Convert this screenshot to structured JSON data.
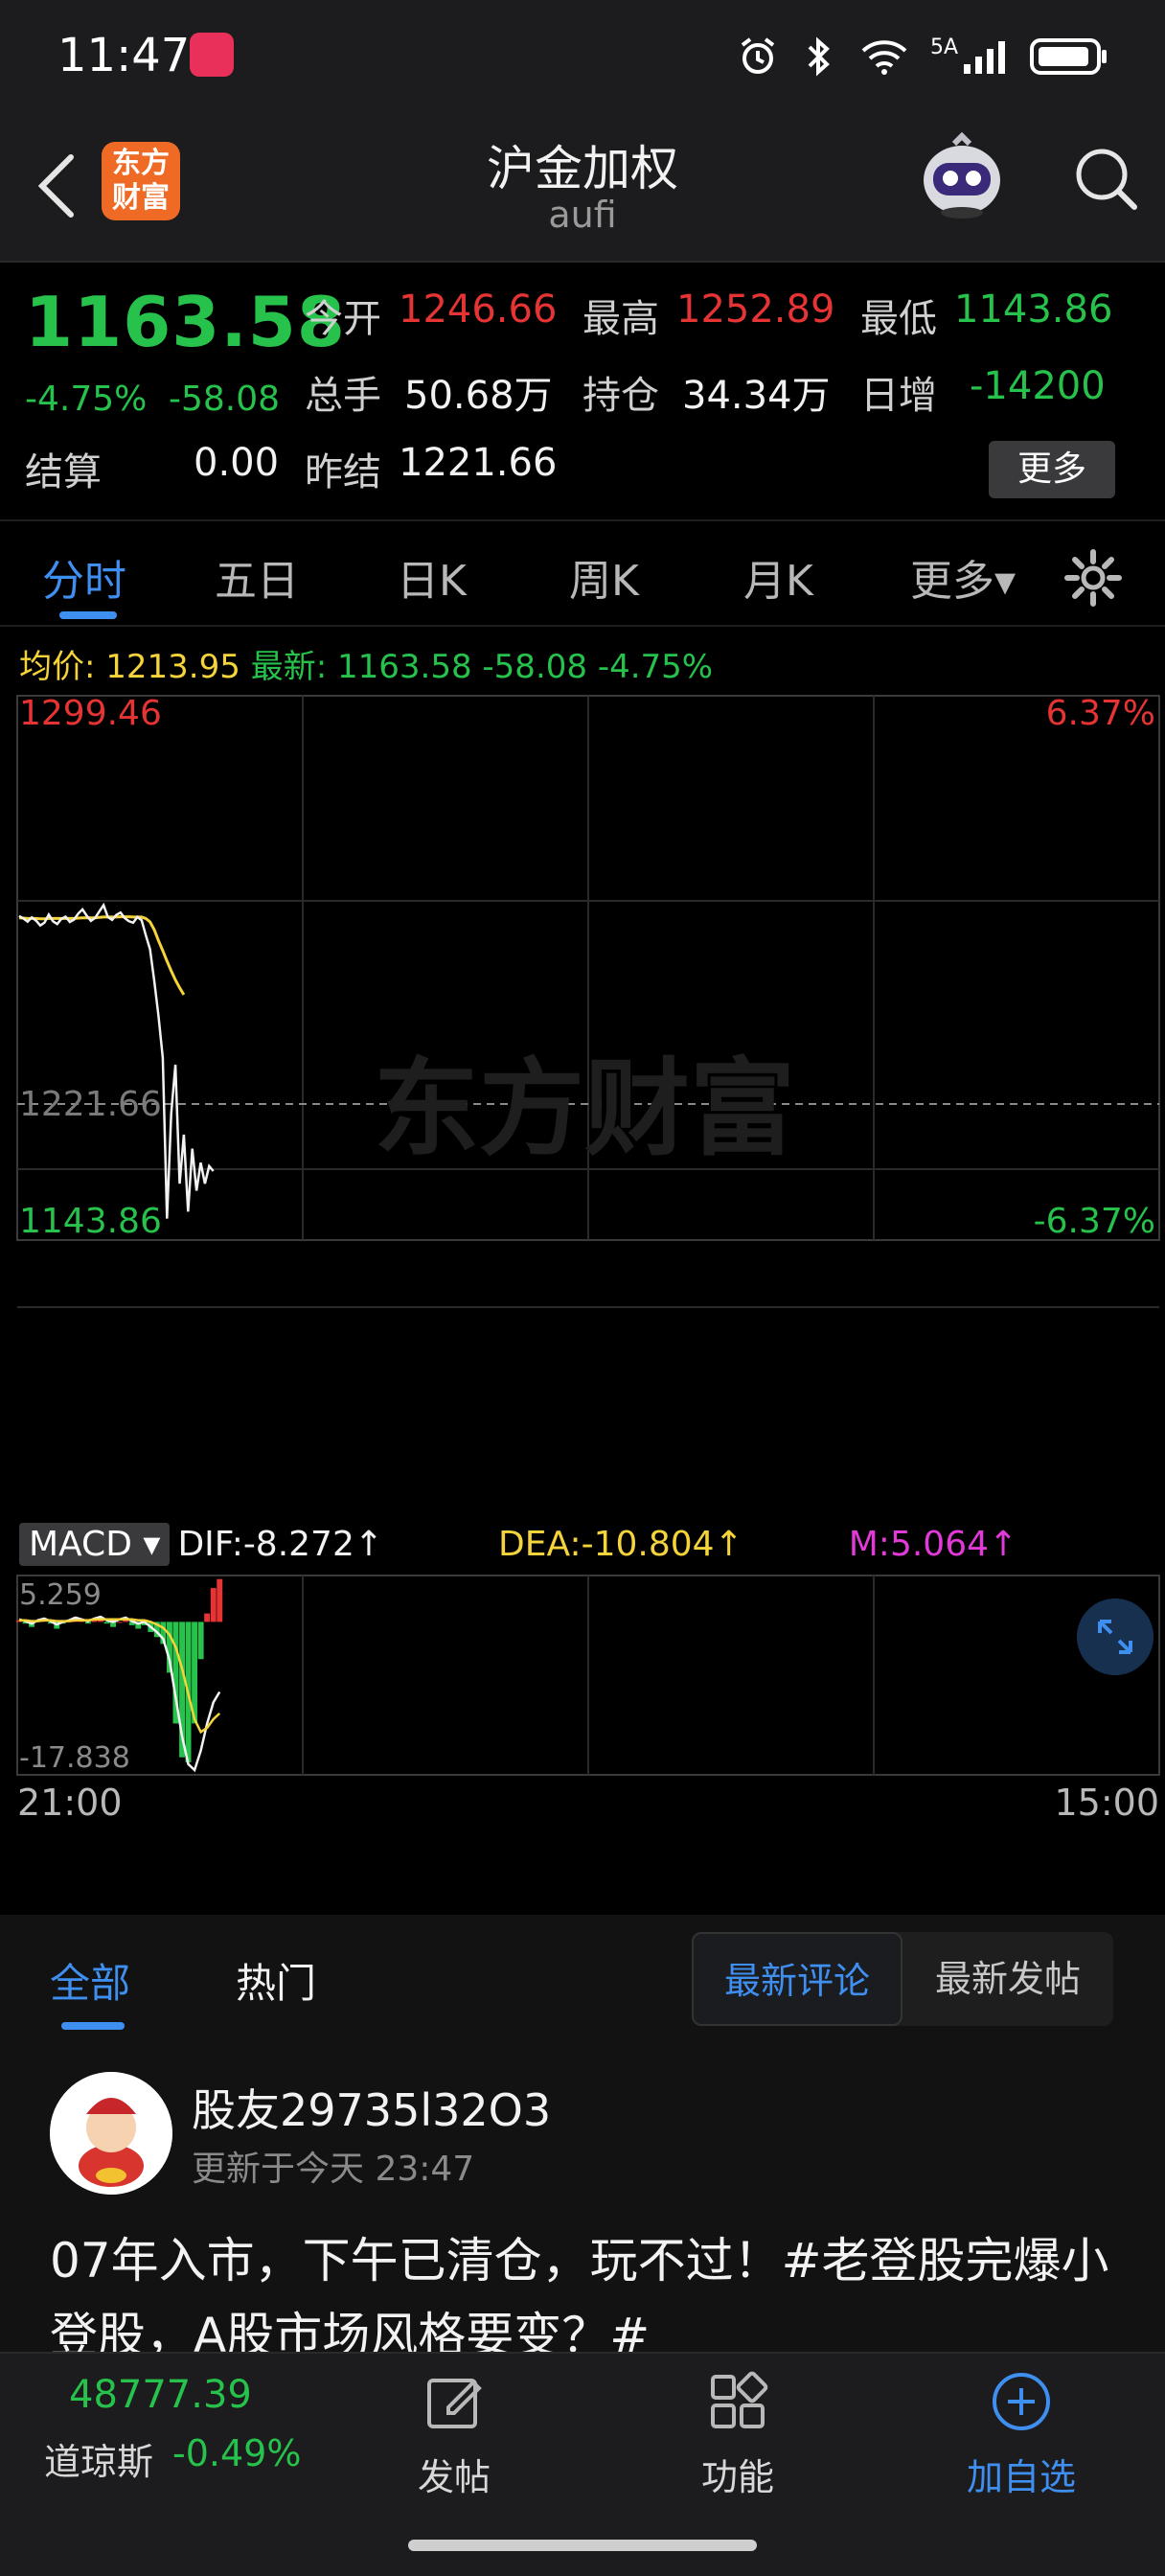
{
  "status_bar": {
    "time": "11:47",
    "network": "5A"
  },
  "header": {
    "title": "沪金加权",
    "subtitle": "aufi",
    "brand_line1": "东方",
    "brand_line2": "财富"
  },
  "quote": {
    "last_price": "1163.58",
    "change_pct": "-4.75%",
    "change_abs": "-58.08",
    "open_label": "今开",
    "open_value": "1246.66",
    "high_label": "最高",
    "high_value": "1252.89",
    "low_label": "最低",
    "low_value": "1143.86",
    "volume_label": "总手",
    "volume_value": "50.68万",
    "oi_label": "持仓",
    "oi_value": "34.34万",
    "daily_inc_label": "日增",
    "daily_inc_value": "-14200",
    "settle_label": "结算",
    "settle_value": "0.00",
    "prev_settle_label": "昨结",
    "prev_settle_value": "1221.66",
    "more_label": "更多"
  },
  "tabs": {
    "items": [
      "分时",
      "五日",
      "日K",
      "周K",
      "月K",
      "更多▾"
    ],
    "active": "分时"
  },
  "info_line": {
    "avg_label": "均价:",
    "avg_value": "1213.95",
    "latest_label": "最新:",
    "latest_value": "1163.58",
    "latest_chg": "-58.08",
    "latest_pct": "-4.75%"
  },
  "chart_data": [
    {
      "type": "line",
      "title": "",
      "series": [],
      "y_ticks_left": [
        "1299.46",
        "1221.66",
        "1143.86"
      ],
      "y_ticks_right": [
        "6.37%",
        "-6.37%"
      ],
      "ylim": [
        1143.86,
        1299.46
      ],
      "reference_line": 1221.66,
      "price": [
        1236.5,
        1235.8,
        1234.9,
        1236.1,
        1235.2,
        1233.8,
        1234.6,
        1236.9,
        1235.0,
        1234.2,
        1235.7,
        1236.3,
        1234.8,
        1235.5,
        1237.2,
        1238.4,
        1236.6,
        1235.1,
        1236.0,
        1237.8,
        1239.6,
        1236.2,
        1235.4,
        1236.8,
        1237.5,
        1235.9,
        1235.0,
        1234.6,
        1236.2,
        1235.3,
        1231.0,
        1227.0,
        1218.0,
        1208.0,
        1196.0,
        1150.0,
        1180.0,
        1194.0,
        1160.0,
        1174.0,
        1152.0,
        1170.0,
        1158.0,
        1166.0,
        1160.0,
        1165.0,
        1163.58
      ],
      "avg_price": [
        1236.0,
        1235.9,
        1235.8,
        1235.8,
        1235.8,
        1235.7,
        1235.7,
        1235.8,
        1235.8,
        1235.8,
        1235.8,
        1235.8,
        1235.8,
        1235.8,
        1235.9,
        1236.0,
        1236.0,
        1236.0,
        1236.0,
        1236.1,
        1236.2,
        1236.2,
        1236.2,
        1236.2,
        1236.3,
        1236.3,
        1236.3,
        1236.2,
        1236.2,
        1236.2,
        1235.8,
        1234.8,
        1232.6,
        1229.5,
        1226.6,
        1223.6,
        1220.8,
        1218.2,
        1216.0,
        1214.0
      ],
      "x_ticks": [
        "21:00",
        "15:00"
      ]
    },
    {
      "type": "line",
      "title": "MACD",
      "series": [],
      "dif": "DIF:-8.272↑",
      "dea": "DEA:-10.804↑",
      "m": "M:5.064↑",
      "ylim": [
        -17.838,
        5.259
      ],
      "y_ticks": [
        "5.259",
        "-17.838"
      ],
      "dif_values": [
        0.3,
        0.1,
        -0.2,
        0.2,
        0.4,
        0.1,
        -0.3,
        0.0,
        0.2,
        0.5,
        0.3,
        0.1,
        0.4,
        0.6,
        0.2,
        0.0,
        0.3,
        0.5,
        0.1,
        -0.2,
        0.0,
        -0.6,
        -1.2,
        -2.0,
        -4.5,
        -9.0,
        -13.5,
        -16.8,
        -17.5,
        -15.2,
        -12.0,
        -9.5,
        -8.272
      ],
      "dea_values": [
        0.2,
        0.2,
        0.1,
        0.1,
        0.2,
        0.2,
        0.1,
        0.1,
        0.1,
        0.2,
        0.2,
        0.2,
        0.3,
        0.3,
        0.3,
        0.3,
        0.3,
        0.3,
        0.3,
        0.2,
        0.2,
        0.0,
        -0.3,
        -0.7,
        -1.5,
        -3.0,
        -5.5,
        -8.5,
        -11.5,
        -13.0,
        -12.5,
        -11.5,
        -10.804
      ],
      "bars": [
        0.2,
        -0.2,
        -0.6,
        0.2,
        0.4,
        -0.2,
        -0.8,
        -0.2,
        0.2,
        0.6,
        0.2,
        -0.2,
        0.2,
        0.6,
        -0.2,
        -0.6,
        0.0,
        0.4,
        -0.4,
        -0.8,
        -0.4,
        -1.2,
        -1.8,
        -2.6,
        -6.0,
        -12.0,
        -16.0,
        -16.6,
        -12.0,
        -4.4,
        1.0,
        4.0,
        5.064
      ]
    }
  ],
  "comments": {
    "tabs": [
      "全部",
      "热门"
    ],
    "sort_options": [
      "最新评论",
      "最新发帖"
    ],
    "post": {
      "username": "股友29735l32O3",
      "time": "更新于今天 23:47",
      "text": "07年入市，下午已清仓，玩不过！#老登股完爆小登股，A股市场风格要变？#"
    }
  },
  "bottom_bar": {
    "index_value": "48777.39",
    "index_name": "道琼斯",
    "index_change": "-0.49%",
    "post_label": "发帖",
    "function_label": "功能",
    "add_watch_label": "加自选"
  },
  "colors": {
    "up": "#e63434",
    "down": "#27c24c",
    "accent": "#3f8ff0",
    "avg_line": "#f5d33a",
    "magenta": "#e23ad9"
  }
}
